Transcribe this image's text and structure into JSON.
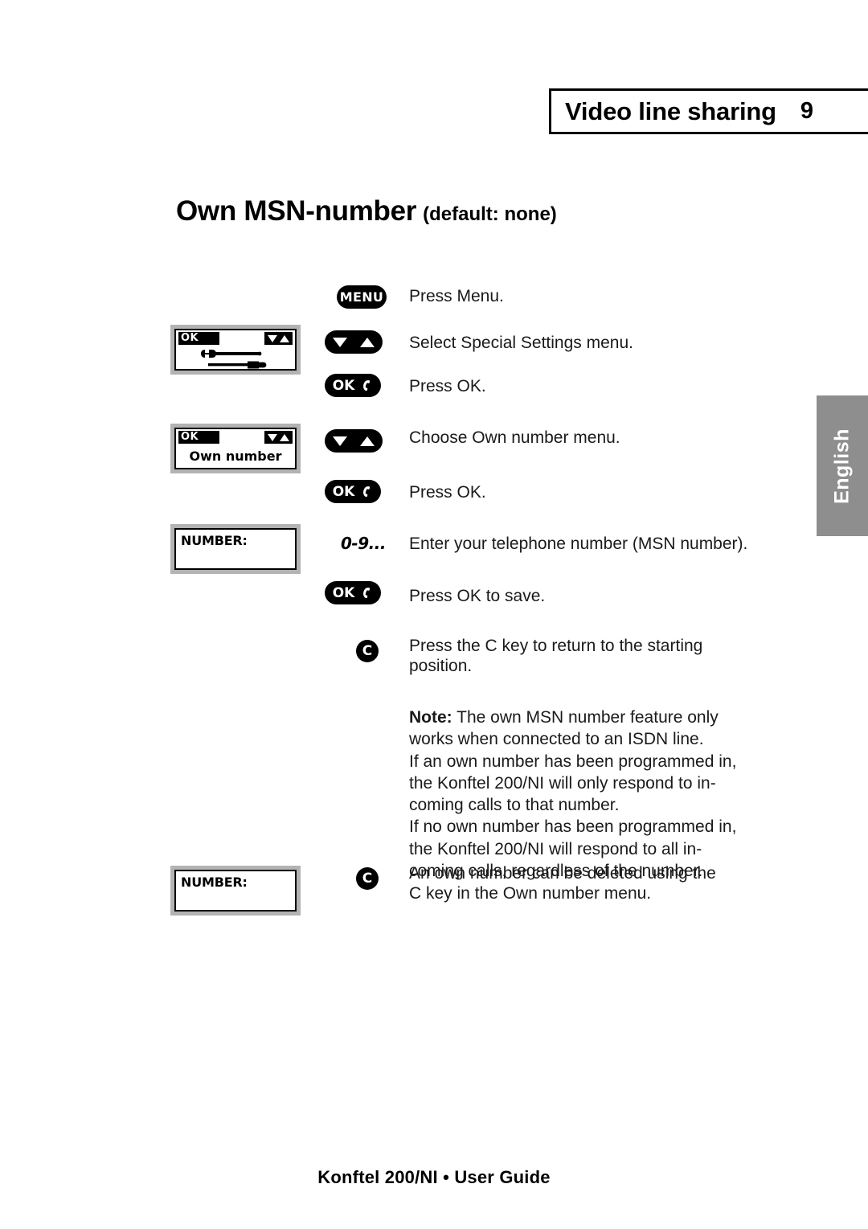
{
  "header": {
    "title": "Video line sharing",
    "chapter": "9"
  },
  "section": {
    "title": "Own MSN-number",
    "subtitle": "(default: none)"
  },
  "language_tab": {
    "label": "English"
  },
  "displays": {
    "special_settings": {
      "ok_label": "OK",
      "icon": "wrench-screwdriver-icon"
    },
    "own_number": {
      "ok_label": "OK",
      "text": "Own number"
    },
    "number_entry": {
      "text": "NUMBER:"
    },
    "number_delete": {
      "text": "NUMBER:"
    }
  },
  "keys": {
    "menu": "MENU",
    "arrows": "down-up-arrows",
    "ok": "OK",
    "c": "C",
    "digits": "0-9..."
  },
  "steps": [
    {
      "key": "menu",
      "text": "Press Menu."
    },
    {
      "key": "arrows",
      "text": "Select Special Settings menu."
    },
    {
      "key": "ok",
      "text": "Press OK."
    },
    {
      "key": "arrows",
      "text": "Choose Own number menu."
    },
    {
      "key": "ok",
      "text": "Press OK."
    },
    {
      "key": "digits",
      "text": "Enter your telephone number (MSN number)."
    },
    {
      "key": "ok",
      "text": "Press OK to save."
    },
    {
      "key": "c",
      "text": "Press the C key to return to the starting position."
    }
  ],
  "note": {
    "label": "Note:",
    "body": " The own MSN number feature only works when connected to an ISDN line.",
    "line2": "If an own number has been programmed in, the Konftel 200/NI will only respond to in-coming calls to that number.",
    "line3": "If no own number has been programmed in, the Konftel 200/NI will respond to all in-coming calls, regardless of the number."
  },
  "delete_step": {
    "text": "An own number can be deleted using the C key in the Own number menu."
  },
  "footer": {
    "text": "Konftel 200/NI • User Guide"
  }
}
